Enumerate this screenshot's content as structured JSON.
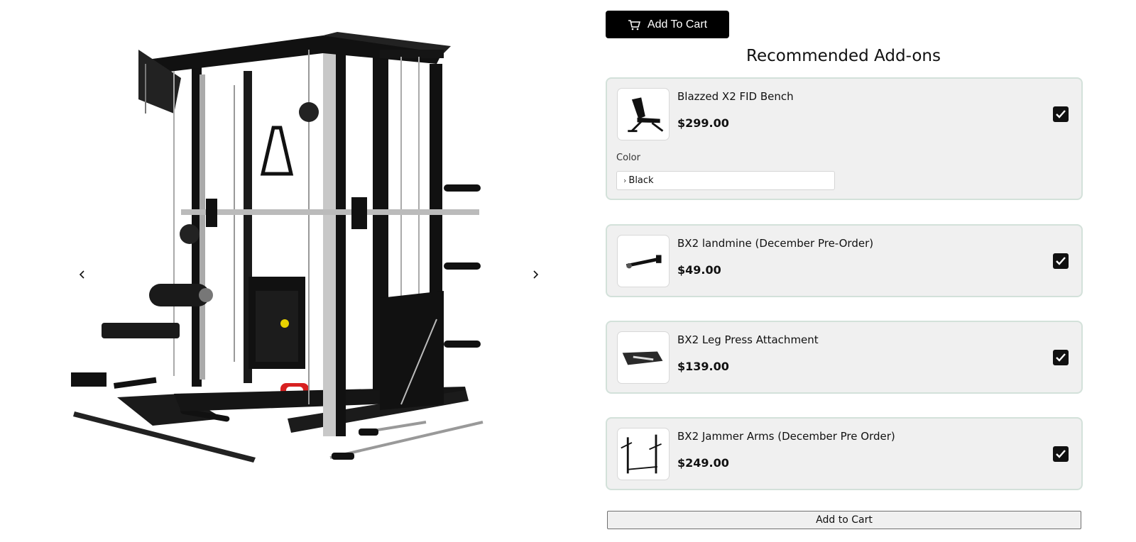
{
  "gallery": {
    "prev_icon": "chevron-left-icon",
    "next_icon": "chevron-right-icon"
  },
  "header": {
    "add_to_cart_label": "Add To Cart",
    "cart_icon": "cart-icon"
  },
  "addons": {
    "title": "Recommended Add-ons",
    "items": [
      {
        "name": "Blazzed X2 FID Bench",
        "price": "$299.00",
        "checked": true,
        "color_label": "Color",
        "color_value": "Black"
      },
      {
        "name": "BX2 landmine (December Pre-Order)",
        "price": "$49.00",
        "checked": true
      },
      {
        "name": "BX2 Leg Press Attachment",
        "price": "$139.00",
        "checked": true
      },
      {
        "name": "BX2 Jammer Arms (December Pre Order)",
        "price": "$249.00",
        "checked": true
      }
    ]
  },
  "footer": {
    "add_to_cart_label": "Add to Cart"
  }
}
